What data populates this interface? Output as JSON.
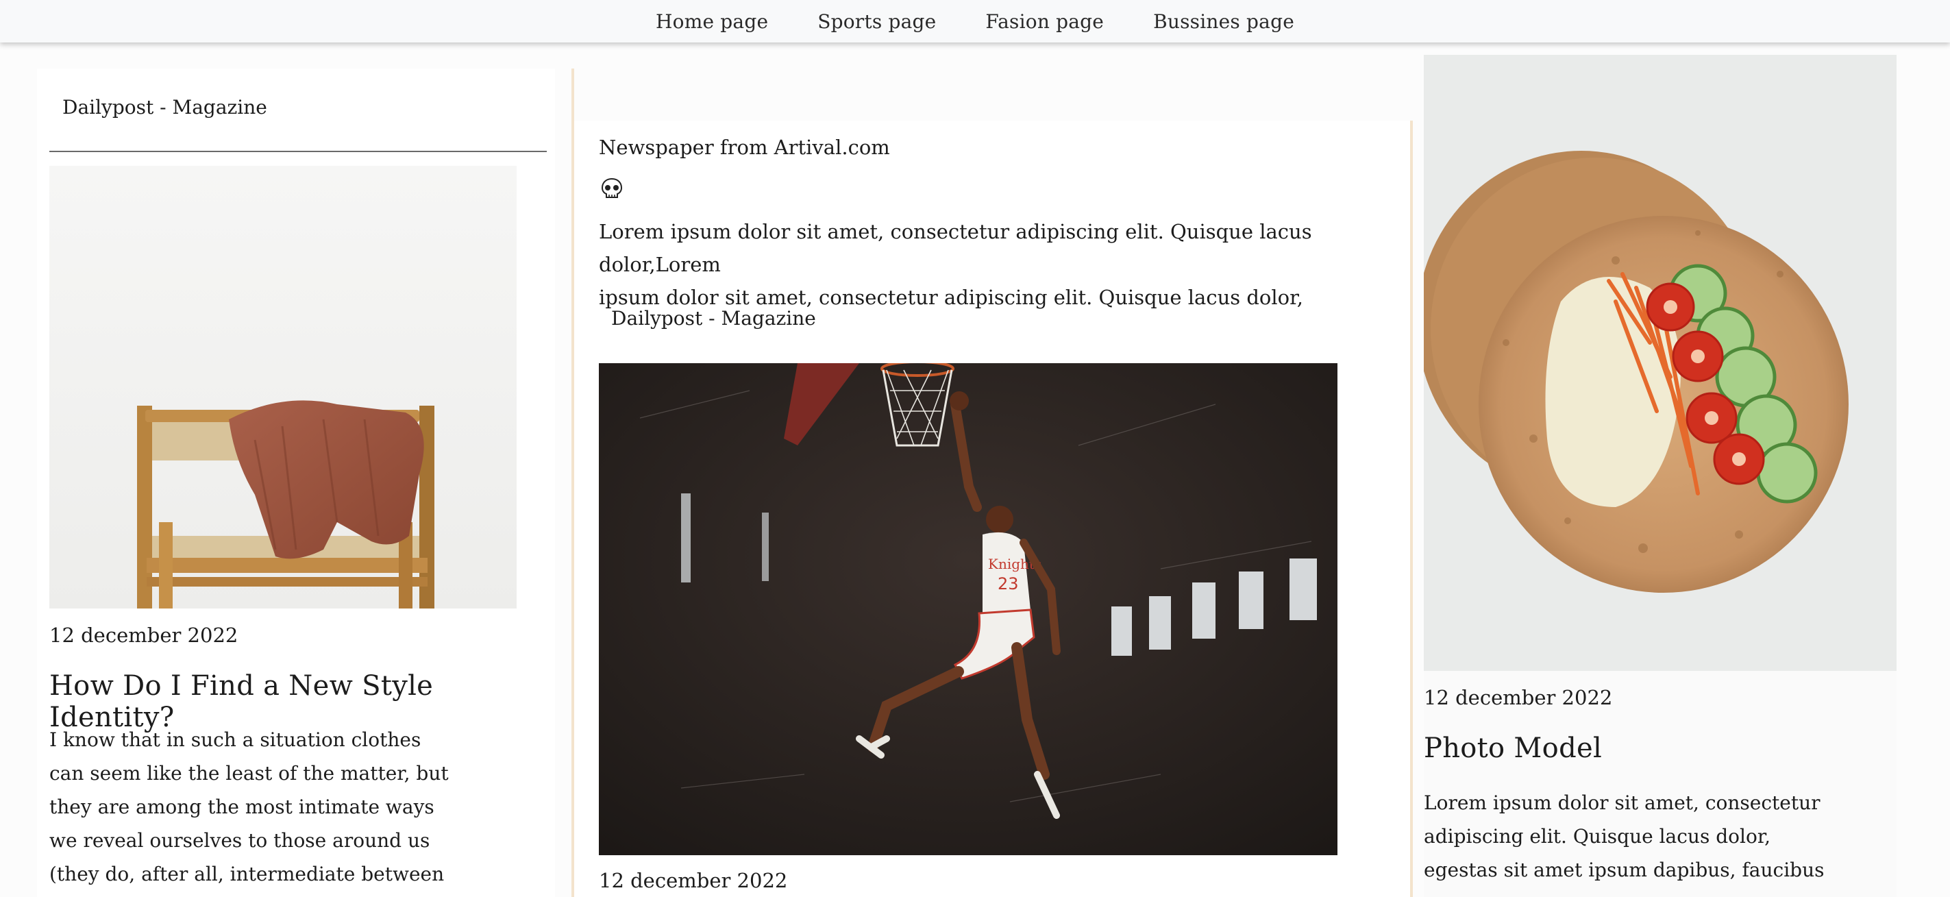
{
  "nav": {
    "items": [
      "Home page",
      "Sports page",
      "Fasion page",
      "Bussines page"
    ]
  },
  "left": {
    "brand": "Dailypost - Magazine",
    "image_alt": "chair-with-knitted-sweater",
    "date": "12 december 2022",
    "title": "How Do I Find a New Style Identity?",
    "body_lines": [
      "I know that in such a situation clothes",
      "can seem like the least of the matter, but",
      "they are among the most intimate ways",
      "we reveal ourselves to those around us",
      "(they do, after all, intermediate between"
    ]
  },
  "middle": {
    "source": "Newspaper from Artival.com",
    "icon": "skull-icon",
    "intro_lines": [
      "Lorem ipsum dolor sit amet, consectetur adipiscing elit. Quisque lacus dolor,Lorem",
      "ipsum dolor sit amet, consectetur adipiscing elit. Quisque lacus dolor,"
    ],
    "brand": "Dailypost - Magazine",
    "image_alt": "basketball-player-dunking",
    "date": "12 december 2022"
  },
  "right": {
    "image_alt": "tortilla-wrap-with-vegetables",
    "date": "12 december 2022",
    "title": "Photo Model",
    "body_lines": [
      "Lorem ipsum dolor sit amet, consectetur",
      "adipiscing elit. Quisque lacus dolor,",
      "egestas sit amet ipsum dapibus, faucibus"
    ]
  }
}
